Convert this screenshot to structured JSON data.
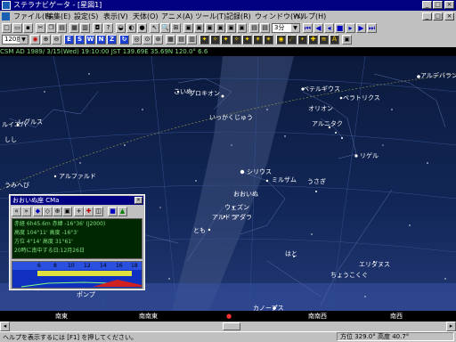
{
  "window": {
    "title": "ステラナビゲータ - [星図1]"
  },
  "menu": [
    {
      "label": "ファイル(F)"
    },
    {
      "label": "編集(E)"
    },
    {
      "label": "設定(S)"
    },
    {
      "label": "表示(V)"
    },
    {
      "label": "天体(O)"
    },
    {
      "label": "アニメ(A)"
    },
    {
      "label": "ツール(T)"
    },
    {
      "label": "記録(R)"
    },
    {
      "label": "ウィンドウ(W)"
    },
    {
      "label": "ヘルプ(H)"
    }
  ],
  "toolbar": {
    "zoom_combo": "120度",
    "letters": [
      "E",
      "S",
      "W",
      "N",
      "Z"
    ],
    "step_combo": "3分"
  },
  "infobar": {
    "text": "CSM  AD 1989/ 3/15(Wed) 19:10:00 JST  139.69E 35.69N  120.0°  6.6"
  },
  "sky_labels": {
    "rukaba": "ルイエバ",
    "regulus": "レグルス",
    "shishi": "しし",
    "kozai": "こいぬ",
    "procyon": "プロキオン",
    "ikkaku": "いっかくじゅう",
    "betelgeuse": "ベテルギウス",
    "bellatrix": "ベラトリクス",
    "orion": "オリオン",
    "alnitak": "アルニタク",
    "rigel": "リゲル",
    "aldebaran": "アルデバラン",
    "sirius": "シリウス",
    "mirzam": "ミルザム",
    "usagi": "うさぎ",
    "alphard": "アルファルド",
    "umihebi": "うみへび",
    "ooinu": "おおいぬ",
    "wezen": "ウェズン",
    "aludra": "アルドラ",
    "adhara": "アダラ",
    "tomo": "とも",
    "hato": "はと",
    "eridanus": "エリダヌス",
    "chokoku": "ちょうこくぐ",
    "canopus": "カノープス",
    "ponpu": "ポンプ"
  },
  "directions": {
    "se": "南東",
    "sse": "南南東",
    "s": "南",
    "ssw": "南南西",
    "sw": "南西"
  },
  "panel": {
    "title": "おおいぬ座 CMa",
    "lines": [
      "赤経 6h45.6m  赤緯 -16°36' (J2000)",
      "高度 104°11'  高度 -16°3'",
      "方位 4°14'  高度 31°61'",
      "20時に南中する日:12月26日"
    ],
    "scale": [
      "6",
      "8",
      "10",
      "12",
      "14",
      "16",
      "18"
    ]
  },
  "status": {
    "help": "ヘルプを表示するには [F1] を押してください。",
    "azimuth": "方位 329.0° 高度 40.7°"
  }
}
